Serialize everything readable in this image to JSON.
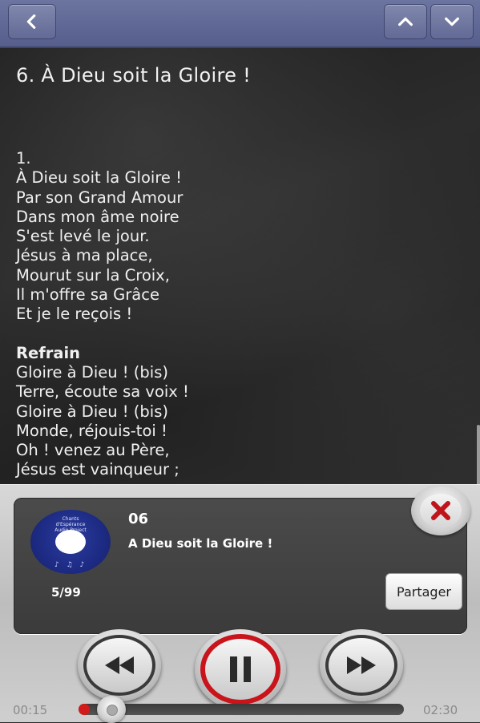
{
  "topbar": {
    "back_icon": "chevron-left-icon",
    "up_icon": "chevron-up-icon",
    "down_icon": "chevron-down-icon"
  },
  "song": {
    "title": "6. À Dieu soit la Gloire !",
    "verse_number": "1.",
    "verse_lines": [
      "À Dieu soit la Gloire !",
      "Par son Grand Amour",
      "Dans mon âme noire",
      "S'est levé le jour.",
      "Jésus à ma place,",
      "Mourut sur la Croix,",
      "Il m'offre sa Grâce",
      "Et je le reçois !"
    ],
    "refrain_label": "Refrain",
    "refrain_lines": [
      "Gloire à Dieu ! (bis)",
      "Terre, écoute sa voix !",
      "Gloire à Dieu ! (bis)",
      "Monde, réjouis-toi !",
      "Oh ! venez au Père,",
      "Jésus est vainqueur ;"
    ]
  },
  "player": {
    "track_number": "06",
    "track_title": "A Dieu soit la Gloire !",
    "position": "5/99",
    "share_label": "Partager",
    "time_elapsed": "00:15",
    "time_total": "02:30",
    "progress": 0.1,
    "colors": {
      "accent": "#c8141a",
      "panel": "#444444"
    }
  }
}
